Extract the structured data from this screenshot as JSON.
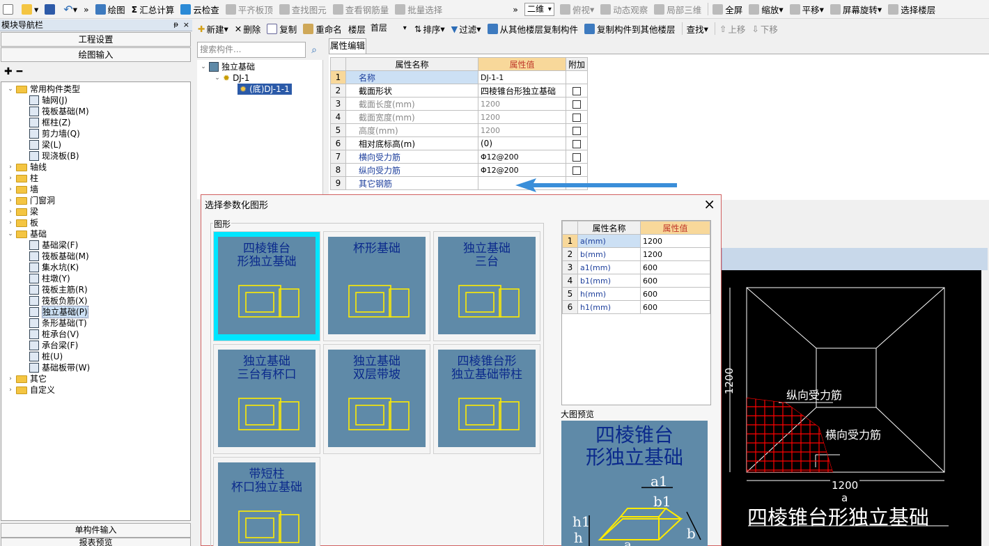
{
  "toolbar": {
    "items": [
      "绘图",
      "汇总计算",
      "云检查",
      "平齐板顶",
      "查找图元",
      "查看钢筋量",
      "批量选择"
    ],
    "view_mode": "二维",
    "view_items": [
      "俯视",
      "动态观察",
      "局部三维",
      "全屏",
      "缩放",
      "平移",
      "屏幕旋转",
      "选择楼层"
    ]
  },
  "toolbar2": {
    "items": [
      "新建",
      "删除",
      "复制",
      "重命名",
      "楼层",
      "首层",
      "排序",
      "过滤",
      "从其他楼层复制构件",
      "复制构件到其他楼层",
      "查找",
      "上移",
      "下移"
    ]
  },
  "nav": {
    "title": "模块导航栏",
    "pin": "ᵽ",
    "close": "×",
    "btn_project": "工程设置",
    "btn_draw": "绘图输入",
    "tree": [
      {
        "label": "常用构件类型",
        "level": 0,
        "folder": true,
        "open": true
      },
      {
        "label": "轴网(J)",
        "level": 1
      },
      {
        "label": "筏板基础(M)",
        "level": 1
      },
      {
        "label": "框柱(Z)",
        "level": 1
      },
      {
        "label": "剪力墙(Q)",
        "level": 1
      },
      {
        "label": "梁(L)",
        "level": 1
      },
      {
        "label": "现浇板(B)",
        "level": 1
      },
      {
        "label": "轴线",
        "level": 0,
        "folder": true
      },
      {
        "label": "柱",
        "level": 0,
        "folder": true
      },
      {
        "label": "墙",
        "level": 0,
        "folder": true
      },
      {
        "label": "门窗洞",
        "level": 0,
        "folder": true
      },
      {
        "label": "梁",
        "level": 0,
        "folder": true
      },
      {
        "label": "板",
        "level": 0,
        "folder": true
      },
      {
        "label": "基础",
        "level": 0,
        "folder": true,
        "open": true
      },
      {
        "label": "基础梁(F)",
        "level": 1
      },
      {
        "label": "筏板基础(M)",
        "level": 1
      },
      {
        "label": "集水坑(K)",
        "level": 1
      },
      {
        "label": "柱墩(Y)",
        "level": 1
      },
      {
        "label": "筏板主筋(R)",
        "level": 1
      },
      {
        "label": "筏板负筋(X)",
        "level": 1
      },
      {
        "label": "独立基础(P)",
        "level": 1,
        "selected": true
      },
      {
        "label": "条形基础(T)",
        "level": 1
      },
      {
        "label": "桩承台(V)",
        "level": 1
      },
      {
        "label": "承台梁(F)",
        "level": 1
      },
      {
        "label": "桩(U)",
        "level": 1
      },
      {
        "label": "基础板带(W)",
        "level": 1
      },
      {
        "label": "其它",
        "level": 0,
        "folder": true
      },
      {
        "label": "自定义",
        "level": 0,
        "folder": true
      }
    ],
    "bottom1": "单构件输入",
    "bottom2": "报表预览"
  },
  "component_tree": {
    "search_placeholder": "搜索构件...",
    "root": "独立基础",
    "child": "DJ-1",
    "leaf": "(底)DJ-1-1"
  },
  "property_editor": {
    "tab": "属性编辑",
    "headers": [
      "属性名称",
      "属性值",
      "附加"
    ],
    "rows": [
      {
        "n": "1",
        "name": "名称",
        "value": "DJ-1-1",
        "style": "blue",
        "check": false,
        "has_check": false
      },
      {
        "n": "2",
        "name": "截面形状",
        "value": "四棱锥台形独立基础",
        "style": "",
        "has_check": true
      },
      {
        "n": "3",
        "name": "截面长度(mm)",
        "value": "1200",
        "style": "grey",
        "has_check": true
      },
      {
        "n": "4",
        "name": "截面宽度(mm)",
        "value": "1200",
        "style": "grey",
        "has_check": true
      },
      {
        "n": "5",
        "name": "高度(mm)",
        "value": "1200",
        "style": "grey",
        "has_check": true
      },
      {
        "n": "6",
        "name": "相对底标高(m)",
        "value": "(0)",
        "style": "",
        "has_check": true
      },
      {
        "n": "7",
        "name": "横向受力筋",
        "value": "Φ12@200",
        "style": "blue",
        "has_check": true
      },
      {
        "n": "8",
        "name": "纵向受力筋",
        "value": "Φ12@200",
        "style": "blue",
        "has_check": true
      },
      {
        "n": "9",
        "name": "其它钢筋",
        "value": "",
        "style": "blue",
        "has_check": false
      }
    ]
  },
  "dialog": {
    "title": "选择参数化图形",
    "close": "×",
    "group_label": "图形",
    "shapes": [
      {
        "title": "四棱锥台\n形独立基础",
        "selected": true
      },
      {
        "title": "杯形基础",
        "selected": false
      },
      {
        "title": "独立基础\n三台",
        "selected": false
      },
      {
        "title": "独立基础\n三台有杯口",
        "selected": false
      },
      {
        "title": "独立基础\n双层带坡",
        "selected": false
      },
      {
        "title": "四棱锥台形\n独立基础带柱",
        "selected": false
      },
      {
        "title": "带短柱\n杯口独立基础",
        "selected": false
      }
    ],
    "param_headers": [
      "属性名称",
      "属性值"
    ],
    "params": [
      {
        "n": "1",
        "name": "a(mm)",
        "value": "1200"
      },
      {
        "n": "2",
        "name": "b(mm)",
        "value": "1200"
      },
      {
        "n": "3",
        "name": "a1(mm)",
        "value": "600"
      },
      {
        "n": "4",
        "name": "b1(mm)",
        "value": "600"
      },
      {
        "n": "5",
        "name": "h(mm)",
        "value": "600"
      },
      {
        "n": "6",
        "name": "h1(mm)",
        "value": "600"
      }
    ],
    "preview_label": "大图预览",
    "preview_title": "四棱锥台\n形独立基础",
    "preview_labels": [
      "a1",
      "b1",
      "h1",
      "h",
      "b",
      "a"
    ]
  },
  "cad": {
    "dim_a": "1200",
    "dim_b": "1200",
    "label_long": "纵向受力筋",
    "label_trans": "横向受力筋",
    "label_a": "a",
    "title": "四棱锥台形独立基础"
  },
  "colors": {
    "accent_cyan": "#00e5ff",
    "shape_bg": "#5f8aa8",
    "title_blue": "#0b2a8c",
    "arrow_blue": "#3a8ed9",
    "rebar_red": "#ff0000"
  }
}
